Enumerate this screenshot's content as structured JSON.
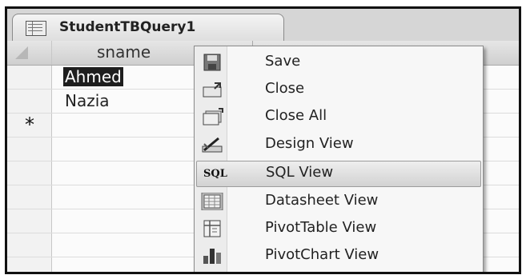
{
  "tab": {
    "title": "StudentTBQuery1"
  },
  "datasheet": {
    "column_header": "sname",
    "rows": [
      "Ahmed",
      "Nazia"
    ],
    "new_record_marker": "*"
  },
  "context_menu": {
    "items": [
      {
        "label": "Save",
        "icon": "save-icon"
      },
      {
        "label": "Close",
        "icon": "close-icon"
      },
      {
        "label": "Close All",
        "icon": "close-all-icon"
      },
      {
        "label": "Design View",
        "icon": "design-view-icon"
      },
      {
        "label": "SQL View",
        "icon": "sql-icon",
        "icon_text": "SQL",
        "highlighted": true
      },
      {
        "label": "Datasheet View",
        "icon": "datasheet-icon"
      },
      {
        "label": "PivotTable View",
        "icon": "pivottable-icon"
      },
      {
        "label": "PivotChart View",
        "icon": "pivotchart-icon"
      }
    ]
  }
}
